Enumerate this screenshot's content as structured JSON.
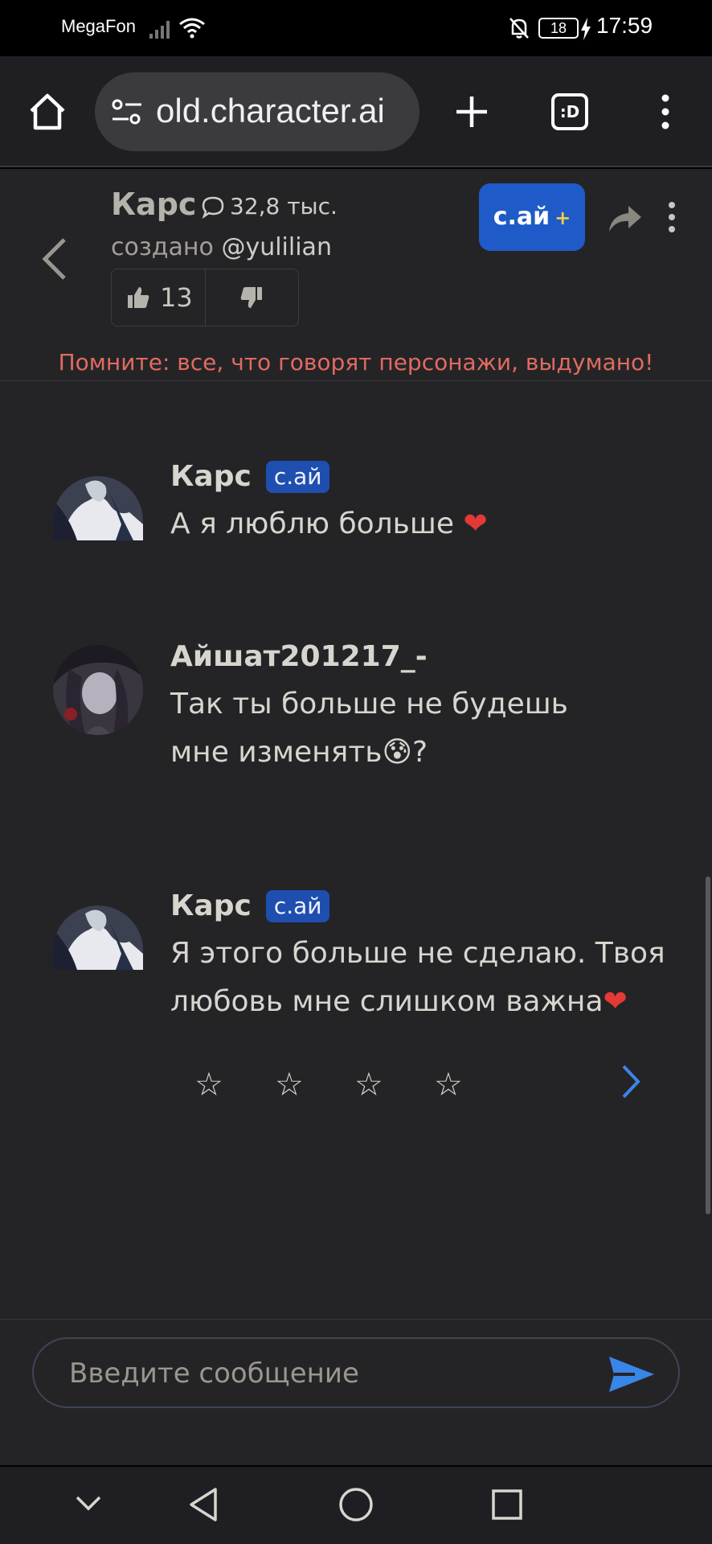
{
  "status_bar": {
    "carrier": "MegaFon",
    "battery": "18",
    "time": "17:59"
  },
  "browser": {
    "url": "old.character.ai",
    "tabs_label": ":D"
  },
  "header": {
    "character_name": "Карс",
    "chat_count": "32,8 тыс.",
    "created_prefix": "создано",
    "creator_handle": "@yulilian",
    "likes": "13",
    "cai_plus_label": "с.ай",
    "cai_plus_suffix": "+",
    "warning": "Помните: все, что говорят персонажи, выдумано!"
  },
  "messages": [
    {
      "author": "Карс",
      "badge": "с.ай",
      "text": "А я люблю больше",
      "emoji": "❤"
    },
    {
      "author": "Айшат201217_-",
      "badge": "",
      "line1": "Так ты больше не будешь",
      "line2": "мне изменять",
      "emoji": "😰",
      "tail": "?"
    },
    {
      "author": "Карс",
      "badge": "с.ай",
      "line1": "Я этого больше не сделаю. Твоя",
      "line2": "любовь мне слишком важна",
      "emoji": "❤"
    }
  ],
  "rating": {
    "stars": [
      "☆",
      "☆",
      "☆",
      "☆"
    ]
  },
  "composer": {
    "placeholder": "Введите сообщение"
  },
  "colors": {
    "accent": "#1e5bc8",
    "warning": "#e06b5f",
    "send": "#3a86e8",
    "background": "#242427"
  }
}
